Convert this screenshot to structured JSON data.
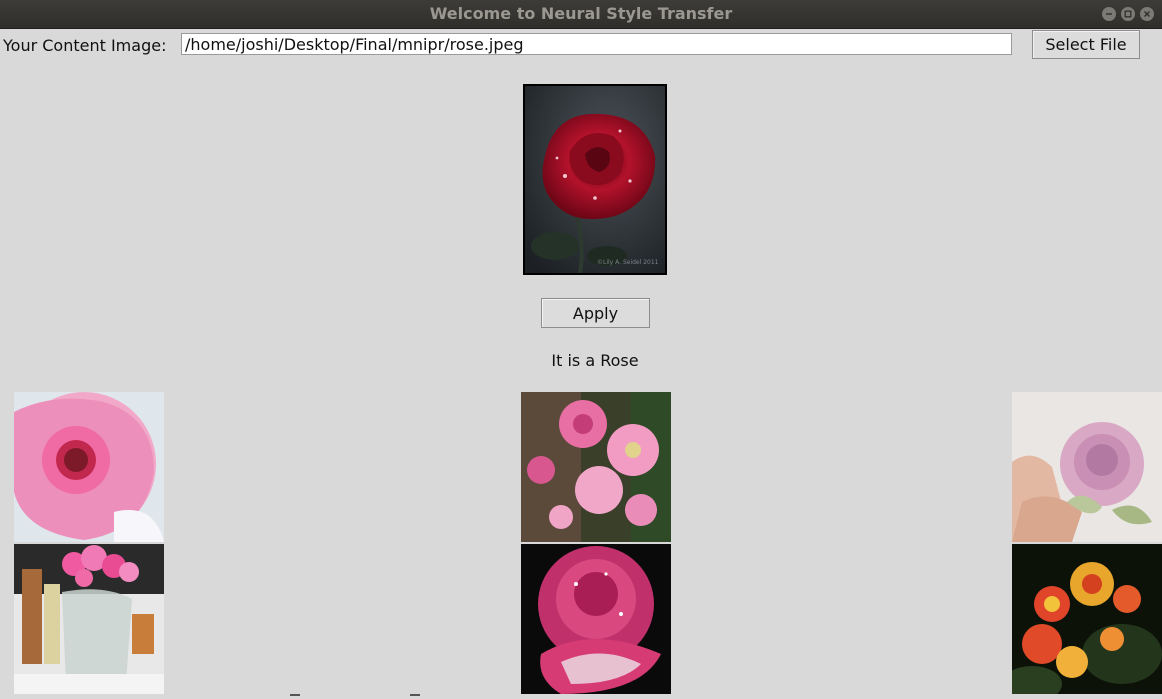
{
  "window": {
    "title": "Welcome to Neural Style Transfer"
  },
  "content_image": {
    "label": "Your Content Image:",
    "path_value": "/home/joshi/Desktop/Final/mnipr/rose.jpeg",
    "select_button": "Select File",
    "preview_watermark": "©Lily A. Seidel 2011"
  },
  "actions": {
    "apply_button": "Apply"
  },
  "result": {
    "text": "It is a Rose"
  },
  "gallery": {
    "thumbnails": [
      {
        "icon": "pink-rose-closeup-image"
      },
      {
        "icon": "pink-roses-bush-image"
      },
      {
        "icon": "pale-pink-rose-in-hand-image"
      },
      {
        "icon": "roses-in-glass-vase-image"
      },
      {
        "icon": "dewy-pink-rose-image"
      },
      {
        "icon": "orange-red-roses-image"
      }
    ]
  },
  "colors": {
    "window_background": "#d9d9d9",
    "titlebar": "#3d3c38"
  }
}
